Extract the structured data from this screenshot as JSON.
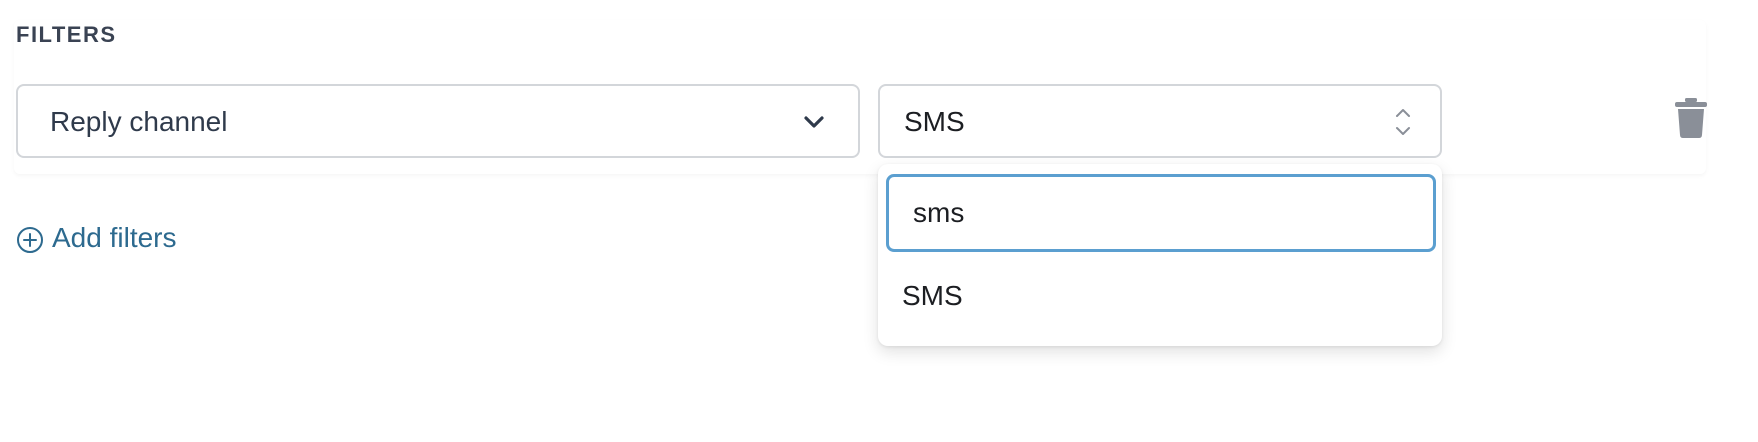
{
  "filters": {
    "section_title": "FILTERS",
    "rows": [
      {
        "field": "Reply channel",
        "value": "SMS"
      }
    ],
    "add_filters_label": "Add filters"
  },
  "dropdown": {
    "search_value": "sms",
    "options": [
      "SMS"
    ]
  },
  "colors": {
    "accent_focus": "#5b9fd0",
    "link": "#2d6a8f",
    "border": "#d3d6da",
    "trash": "#8a8f98"
  },
  "icons": {
    "field_chevron": "chevron-down-icon",
    "value_toggle": "up-down-chevron-icon",
    "delete": "trash-icon",
    "add": "plus-circle-icon"
  }
}
